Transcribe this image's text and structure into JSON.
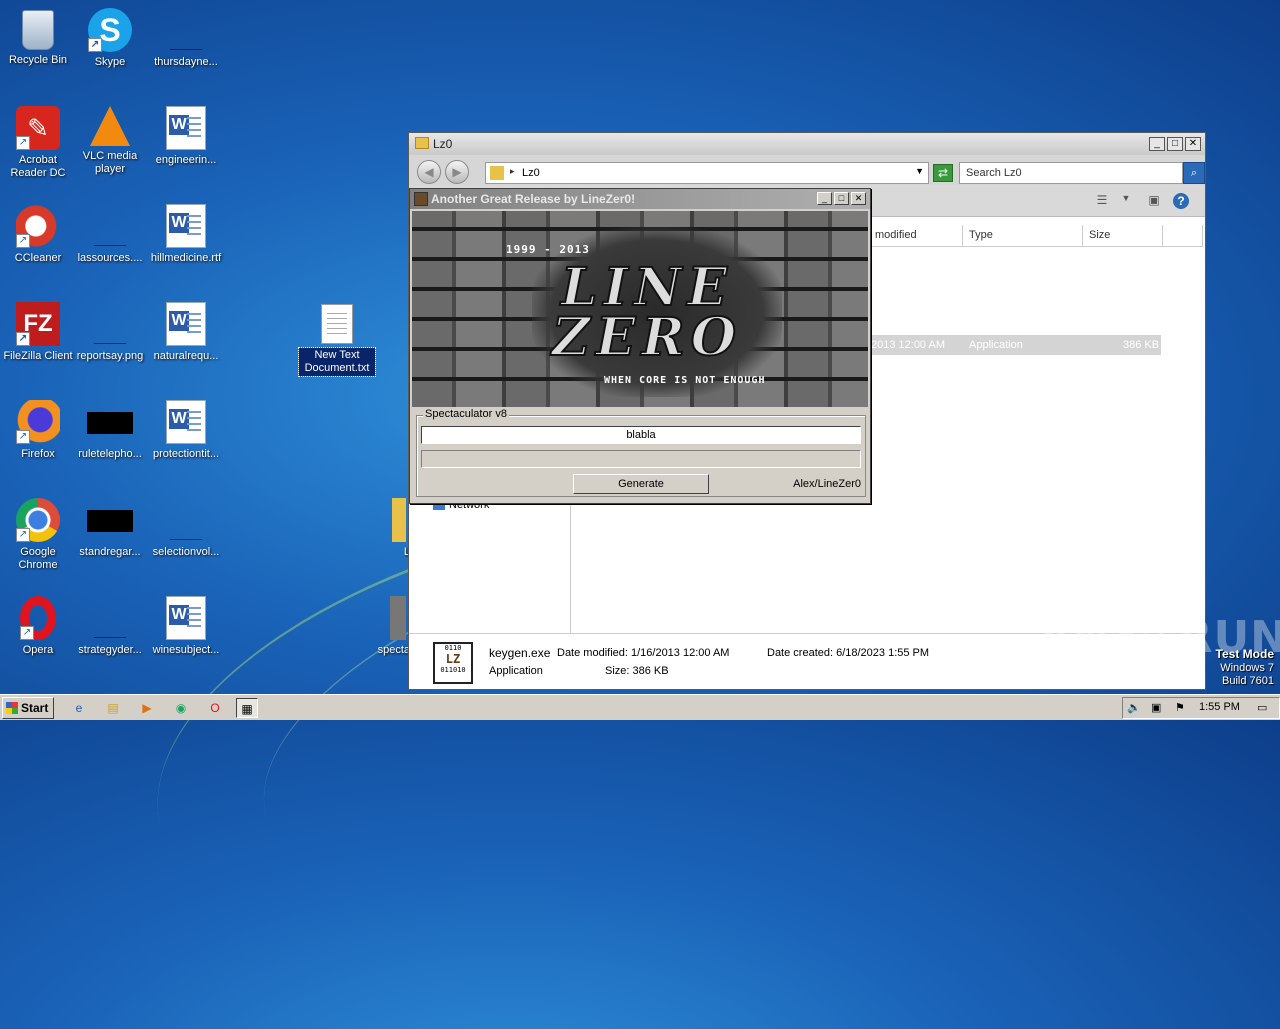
{
  "desktop": {
    "icons": [
      {
        "label": "Recycle Bin"
      },
      {
        "label": "Skype"
      },
      {
        "label": "thursdayne..."
      },
      {
        "label": "Acrobat Reader DC"
      },
      {
        "label": "VLC media player"
      },
      {
        "label": "engineerin..."
      },
      {
        "label": "CCleaner"
      },
      {
        "label": "lassources...."
      },
      {
        "label": "hillmedicine.rtf"
      },
      {
        "label": "FileZilla Client"
      },
      {
        "label": "reportsay.png"
      },
      {
        "label": "naturalrequ..."
      },
      {
        "label": "Firefox"
      },
      {
        "label": "ruletelepho..."
      },
      {
        "label": "protectiontit..."
      },
      {
        "label": "Google Chrome"
      },
      {
        "label": "standregar..."
      },
      {
        "label": "selectionvol..."
      },
      {
        "label": "Opera"
      },
      {
        "label": "strategyder..."
      },
      {
        "label": "winesubject..."
      },
      {
        "label": "New Text Document.txt"
      },
      {
        "label": "L"
      },
      {
        "label": "specta"
      }
    ]
  },
  "explorer": {
    "title": "Lz0",
    "address_path": "Lz0",
    "search_placeholder": "Search Lz0",
    "columns": [
      "modified",
      "Type",
      "Size"
    ],
    "file_row": {
      "modified": "2013 12:00 AM",
      "type": "Application",
      "size": "386 KB"
    },
    "nav_network": "Network",
    "details": {
      "name": "keygen.exe",
      "date_modified": "Date modified: 1/16/2013 12:00 AM",
      "date_created": "Date created: 6/18/2023 1:55 PM",
      "type": "Application",
      "size": "Size: 386 KB",
      "icon_bits_top": "0110",
      "icon_letters": "LZ",
      "icon_bits_bottom": "011010"
    }
  },
  "keygen": {
    "title": "Another Great Release by LineZer0!",
    "banner_years": "1999 - 2013",
    "banner_logo_line1": "LINE",
    "banner_logo_line2": "ZERO",
    "banner_slogan": "WHEN CORE IS NOT ENOUGH",
    "group_label": "Spectaculator v8",
    "input_value": "blabla",
    "output_value": "",
    "generate_label": "Generate",
    "credit": "Alex/LineZer0"
  },
  "window_buttons": {
    "minimize": "_",
    "maximize": "□",
    "close": "✕"
  },
  "watermark": "ANY▷RUN",
  "os_info": {
    "line1": "Test Mode",
    "line2": "Windows 7",
    "line3": "Build 7601"
  },
  "taskbar": {
    "start_label": "Start",
    "clock": "1:55 PM"
  }
}
